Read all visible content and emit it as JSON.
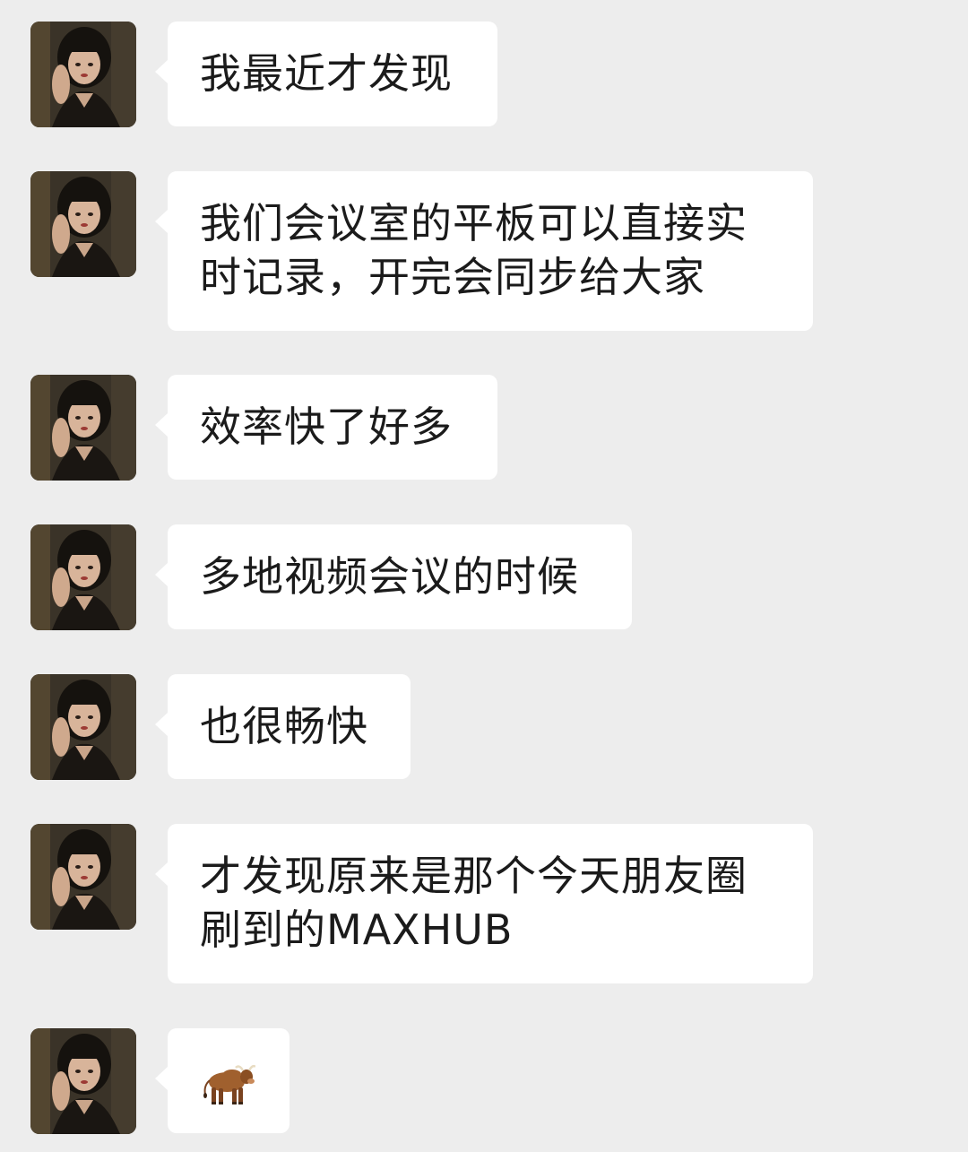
{
  "chat": {
    "messages": [
      {
        "sender": "avatar-woman",
        "text": "我最近才发现"
      },
      {
        "sender": "avatar-woman",
        "text": "我们会议室的平板可以直接实时记录，开完会同步给大家"
      },
      {
        "sender": "avatar-woman",
        "text": "效率快了好多"
      },
      {
        "sender": "avatar-woman",
        "text": "多地视频会议的时候"
      },
      {
        "sender": "avatar-woman",
        "text": "也很畅快"
      },
      {
        "sender": "avatar-woman",
        "text": "才发现原来是那个今天朋友圈刷到的MAXHUB"
      },
      {
        "sender": "avatar-woman",
        "emoji": "ox-emoji"
      }
    ]
  },
  "colors": {
    "background": "#ededed",
    "bubble": "#ffffff",
    "text": "#1b1b1b"
  }
}
